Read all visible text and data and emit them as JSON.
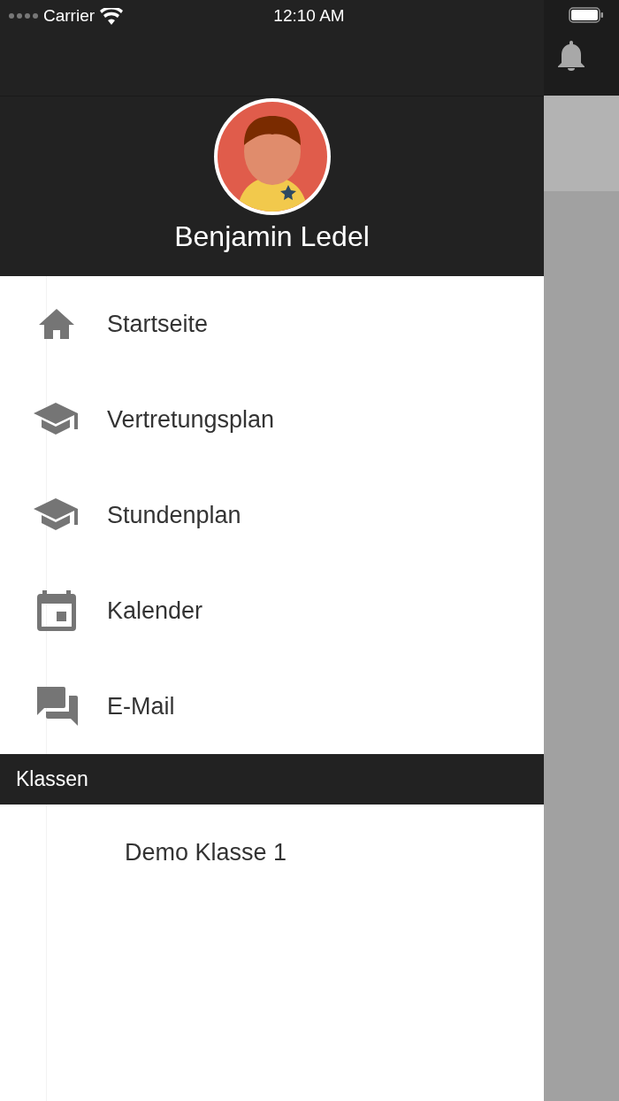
{
  "status_bar": {
    "carrier": "Carrier",
    "time": "12:10 AM"
  },
  "profile": {
    "name": "Benjamin Ledel"
  },
  "menu": [
    {
      "label": "Startseite"
    },
    {
      "label": "Vertretungsplan"
    },
    {
      "label": "Stundenplan"
    },
    {
      "label": "Kalender"
    },
    {
      "label": "E-Mail"
    }
  ],
  "sections": [
    {
      "title": "Klassen",
      "items": [
        {
          "label": "Demo Klasse 1"
        }
      ]
    }
  ]
}
